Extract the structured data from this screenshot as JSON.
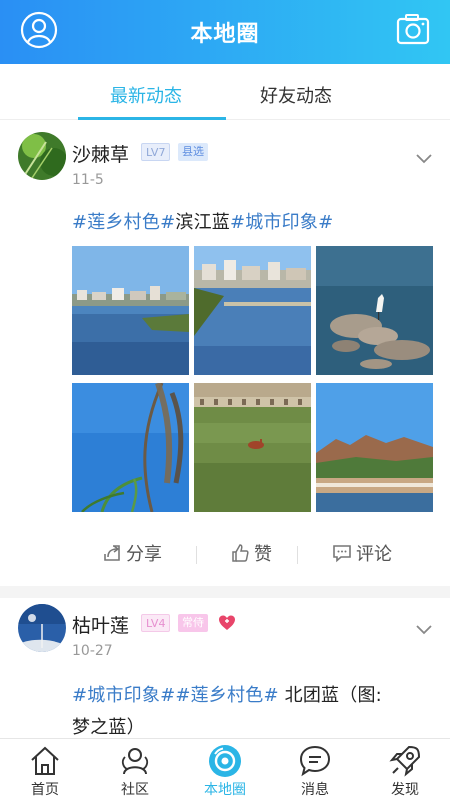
{
  "header": {
    "title": "本地圈"
  },
  "tabs": [
    {
      "label": "最新动态",
      "active": true
    },
    {
      "label": "好友动态",
      "active": false
    }
  ],
  "posts": [
    {
      "user": "沙棘草",
      "level": "LV7",
      "role": "县选",
      "date": "11-5",
      "tags_part1": "#莲乡村色#",
      "tags_part2": "滨江蓝",
      "tags_part3": "#城市印象#",
      "photos": [
        "river-town",
        "riverbank-city",
        "heron-rocks",
        "reed-grass",
        "field-bird",
        "red-cliff-river"
      ],
      "actions": {
        "share": "分享",
        "like": "赞",
        "comment": "评论"
      }
    },
    {
      "user": "枯叶莲",
      "level": "LV4",
      "role": "常侍",
      "date": "10-27",
      "tags_part1": "#城市印象##莲乡村色#",
      "text_rest": " 北团蓝（图:",
      "text_line2": "梦之蓝）"
    }
  ],
  "bottom_nav": [
    {
      "label": "首页",
      "icon": "home-icon",
      "active": false
    },
    {
      "label": "社区",
      "icon": "community-icon",
      "active": false
    },
    {
      "label": "本地圈",
      "icon": "local-circle-icon",
      "active": true
    },
    {
      "label": "消息",
      "icon": "message-icon",
      "active": false
    },
    {
      "label": "发现",
      "icon": "rocket-icon",
      "active": false
    }
  ],
  "colors": {
    "header_start": "#2a8ff4",
    "header_end": "#31c6f3",
    "accent": "#2bb5e6",
    "tag": "#3a7cc8"
  }
}
